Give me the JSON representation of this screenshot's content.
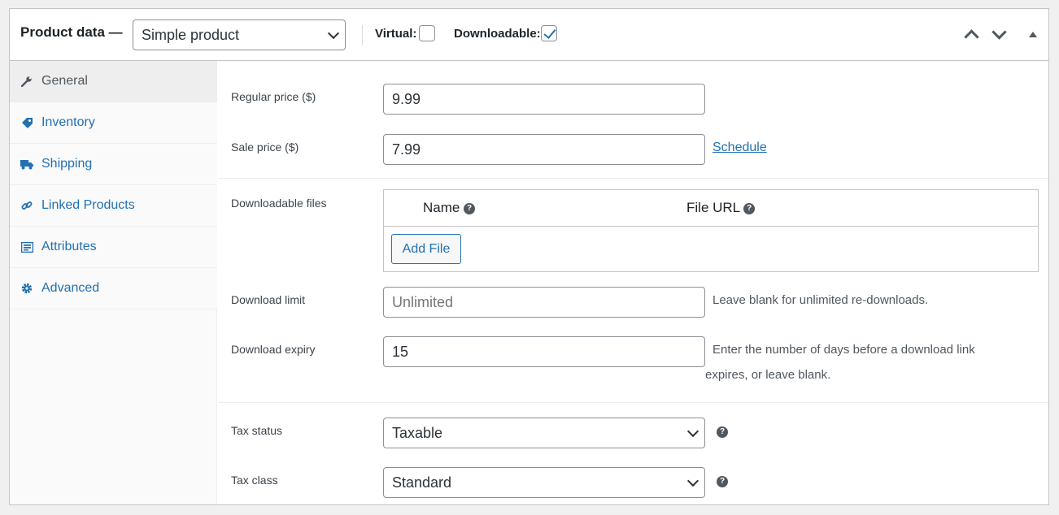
{
  "header": {
    "title": "Product data —",
    "product_type": "Simple product",
    "virtual_label": "Virtual:",
    "virtual_checked": false,
    "downloadable_label": "Downloadable:",
    "downloadable_checked": true
  },
  "sidebar": {
    "items": [
      {
        "label": "General",
        "icon": "wrench-icon",
        "active": true
      },
      {
        "label": "Inventory",
        "icon": "tag-icon",
        "active": false
      },
      {
        "label": "Shipping",
        "icon": "truck-icon",
        "active": false
      },
      {
        "label": "Linked Products",
        "icon": "link-icon",
        "active": false
      },
      {
        "label": "Attributes",
        "icon": "list-icon",
        "active": false
      },
      {
        "label": "Advanced",
        "icon": "gear-icon",
        "active": false
      }
    ]
  },
  "pricing": {
    "regular_label": "Regular price ($)",
    "regular_value": "9.99",
    "sale_label": "Sale price ($)",
    "sale_value": "7.99",
    "schedule_link": "Schedule"
  },
  "downloads": {
    "files_label": "Downloadable files",
    "col_name": "Name",
    "col_url": "File URL",
    "add_file": "Add File",
    "limit_label": "Download limit",
    "limit_placeholder": "Unlimited",
    "limit_hint": "Leave blank for unlimited re-downloads.",
    "expiry_label": "Download expiry",
    "expiry_value": "15",
    "expiry_hint_1": "Enter the number of days before a download link",
    "expiry_hint_2": "expires, or leave blank."
  },
  "tax": {
    "status_label": "Tax status",
    "status_value": "Taxable",
    "class_label": "Tax class",
    "class_value": "Standard"
  },
  "help_glyph": "?",
  "colors": {
    "link": "#2271b1",
    "border": "#8c8f94",
    "text": "#3c434a"
  }
}
